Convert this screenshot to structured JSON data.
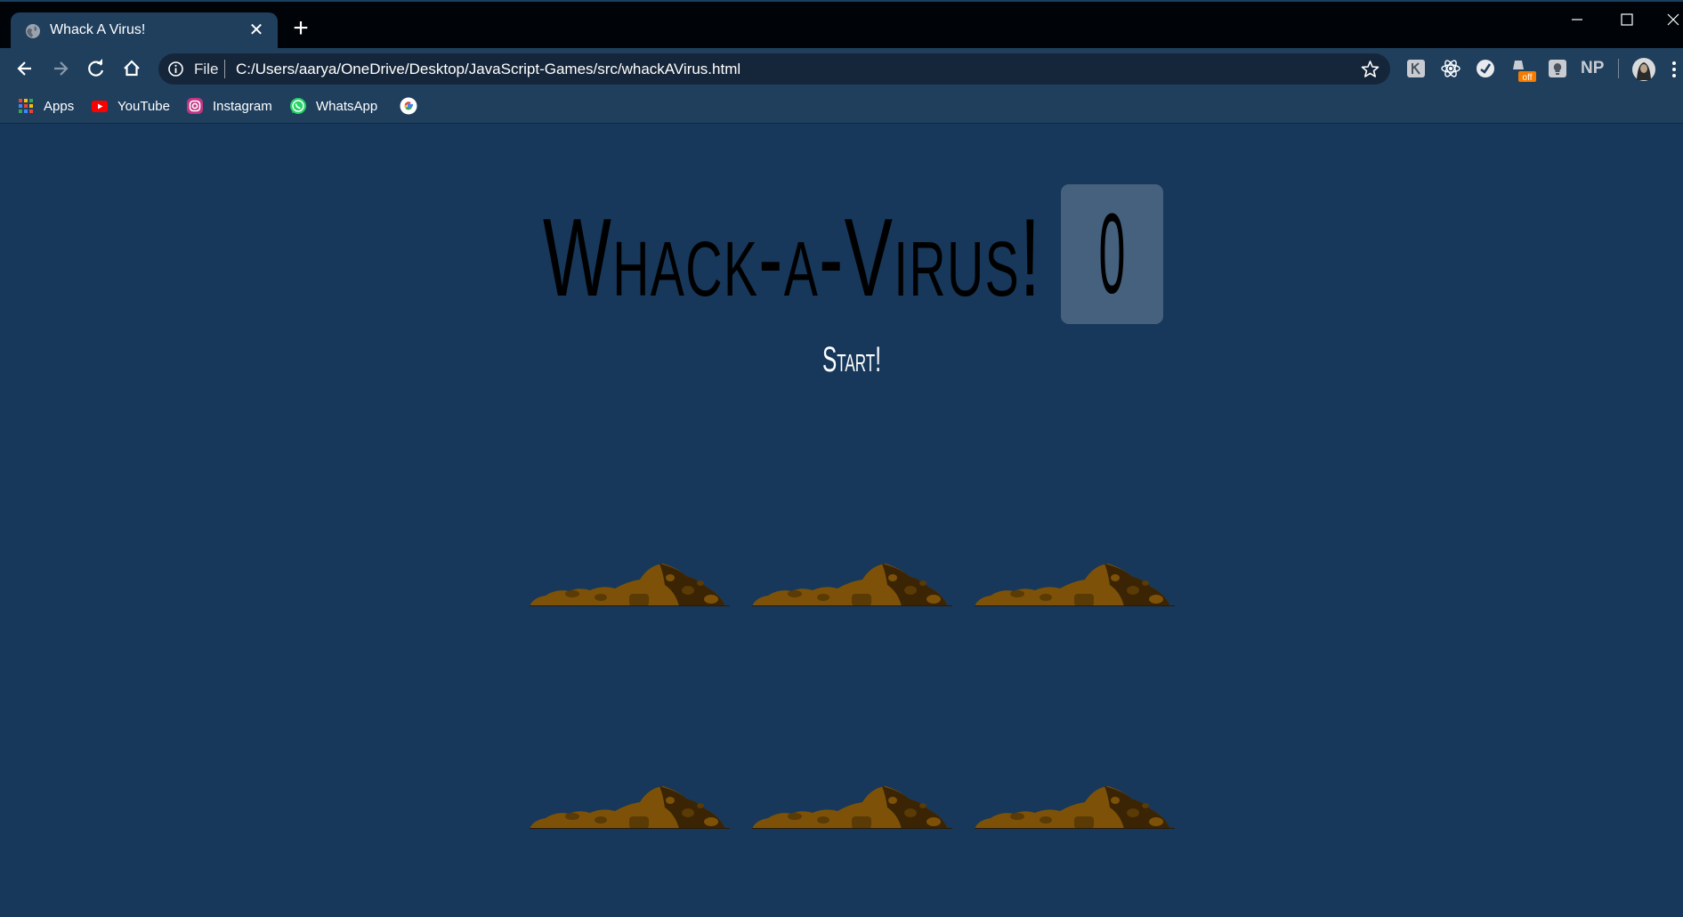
{
  "window": {
    "tab_title": "Whack A Virus!",
    "tab_close_symbol": "✕",
    "new_tab_symbol": "+"
  },
  "toolbar": {
    "file_label": "File",
    "url": "C:/Users/aarya/OneDrive/Desktop/JavaScript-Games/src/whackAVirus.html"
  },
  "bookmarks": [
    {
      "label": "Apps",
      "icon": "apps-grid-icon"
    },
    {
      "label": "YouTube",
      "icon": "youtube-icon"
    },
    {
      "label": "Instagram",
      "icon": "instagram-icon"
    },
    {
      "label": "WhatsApp",
      "icon": "whatsapp-icon"
    },
    {
      "label": "",
      "icon": "google-icon"
    }
  ],
  "extensions": {
    "np_label": "NP",
    "off_badge": "off"
  },
  "game": {
    "title": "Whack-a-Virus!",
    "score": "0",
    "start_label": "Start!",
    "hole_count": 6
  },
  "colors": {
    "page_background": "#17385a",
    "score_box": "#45617e",
    "dirt_light": "#7d5208",
    "dirt_dark": "#3a2404"
  }
}
